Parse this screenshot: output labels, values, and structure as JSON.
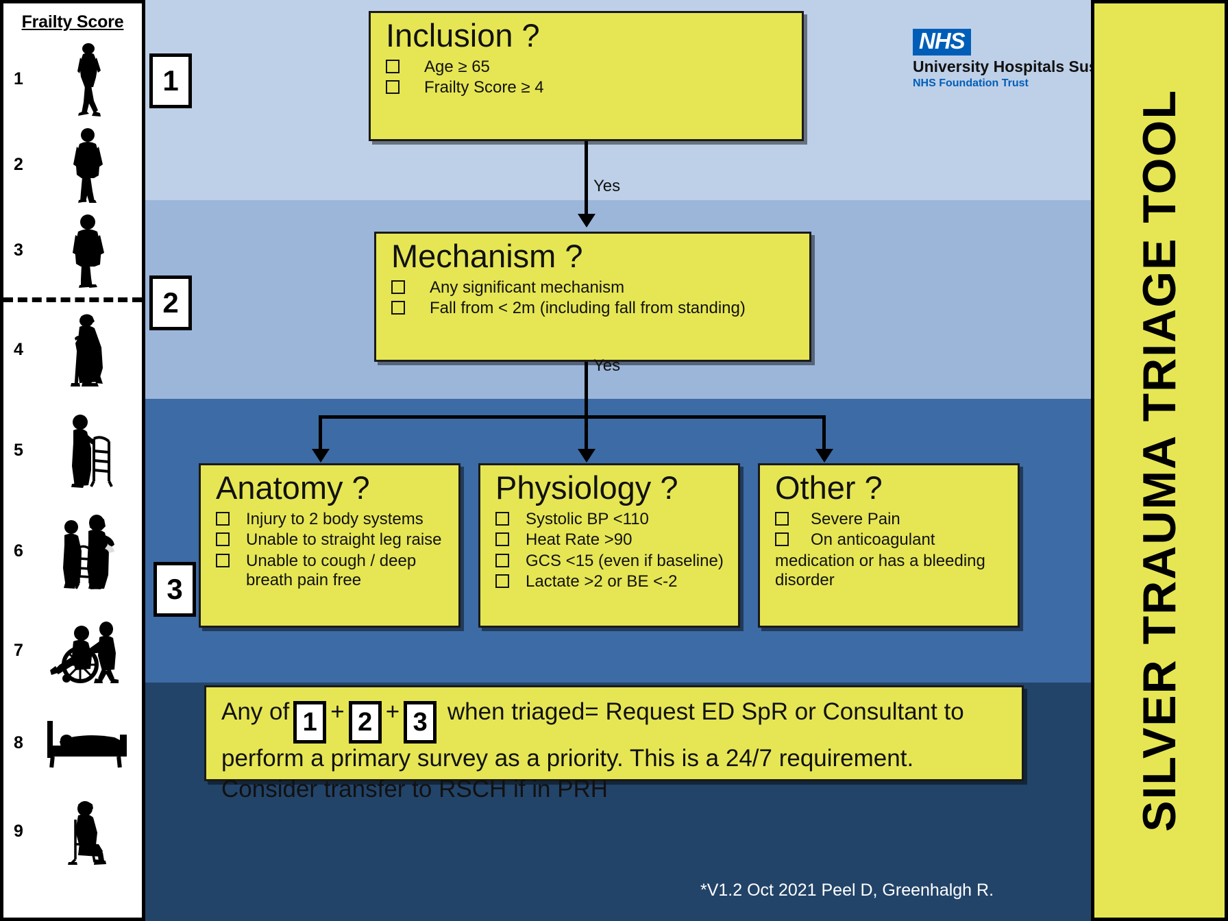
{
  "frailty": {
    "title": "Frailty Score",
    "rows": [
      {
        "num": "1",
        "figure": "walking-person-brisk-icon"
      },
      {
        "num": "2",
        "figure": "walking-person-icon"
      },
      {
        "num": "3",
        "figure": "standing-person-icon"
      },
      {
        "num": "4",
        "figure": "person-with-cane-icon"
      },
      {
        "num": "5",
        "figure": "person-with-walker-icon"
      },
      {
        "num": "6",
        "figure": "person-assisted-walker-icon"
      },
      {
        "num": "7",
        "figure": "person-in-wheelchair-icon"
      },
      {
        "num": "8",
        "figure": "person-in-bed-icon"
      },
      {
        "num": "9",
        "figure": "person-seated-icon"
      }
    ]
  },
  "side_title": "SILVER TRAUMA TRIAGE TOOL",
  "logo": {
    "badge": "NHS",
    "name": "University Hospitals Sussex",
    "trust": "NHS Foundation Trust"
  },
  "steps": {
    "one": "1",
    "two": "2",
    "three": "3"
  },
  "connectors": {
    "yes_1": "Yes",
    "yes_2": "Yes"
  },
  "boxes": {
    "inclusion": {
      "title": "Inclusion ?",
      "items": [
        "Age ≥ 65",
        "Frailty Score ≥ 4"
      ]
    },
    "mechanism": {
      "title": "Mechanism ?",
      "items": [
        "Any significant mechanism",
        "Fall from < 2m (including fall from standing)"
      ]
    },
    "anatomy": {
      "title": "Anatomy ?",
      "items": [
        "Injury to 2 body systems",
        "Unable to straight leg raise",
        "Unable to cough / deep breath pain free"
      ]
    },
    "physiology": {
      "title": "Physiology ?",
      "items": [
        "Systolic BP <110",
        "Heat Rate >90",
        "GCS <15 (even if baseline)",
        "Lactate >2 or BE <-2"
      ]
    },
    "other": {
      "title": "Other ?",
      "items": [
        "Severe Pain",
        "On anticoagulant"
      ],
      "trailing_text": "medication or has a  bleeding disorder"
    }
  },
  "summary": {
    "lead": "Any of",
    "badge_1": "1",
    "plus_1": "+",
    "badge_2": "2",
    "plus_2": "+",
    "badge_3": "3",
    "tail": "when triaged= Request ED SpR or Consultant to perform a primary survey as a priority. This is a 24/7 requirement. Consider transfer to RSCH if in PRH"
  },
  "version": "*V1.2 Oct 2021 Peel D, Greenhalgh R.",
  "colors": {
    "yellow": "#e6e654",
    "band1": "#bed0e8",
    "band2": "#9cb6da",
    "band3": "#3d6ba5",
    "band4": "#234469",
    "nhs_blue": "#005eb8"
  }
}
